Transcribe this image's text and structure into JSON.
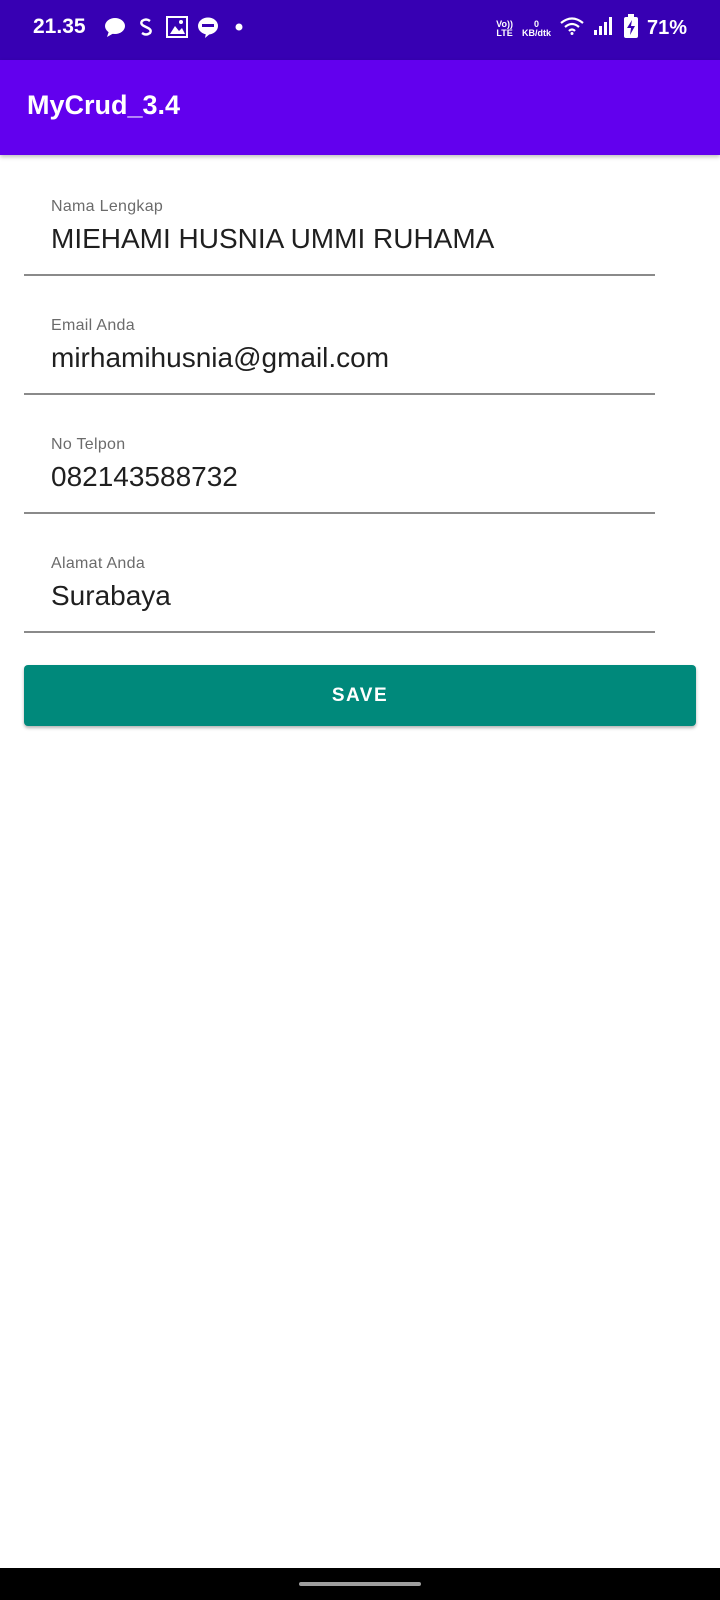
{
  "status_bar": {
    "time": "21.35",
    "notification_icons": [
      "chat-bubble-icon",
      "sync-icon",
      "gallery-icon",
      "line-icon",
      "dot-icon"
    ],
    "volte": "Vo))",
    "lte": "LTE",
    "data_speed_value": "0",
    "data_speed_unit": "KB/dtk",
    "battery_percent": "71%"
  },
  "app_bar": {
    "title": "MyCrud_3.4",
    "color": "#6200ee"
  },
  "form": {
    "fields": [
      {
        "label": "Nama Lengkap",
        "value": "MIEHAMI HUSNIA UMMI RUHAMA"
      },
      {
        "label": "Email Anda",
        "value": "mirhamihusnia@gmail.com"
      },
      {
        "label": "No Telpon",
        "value": "082143588732"
      },
      {
        "label": "Alamat Anda",
        "value": "Surabaya"
      }
    ],
    "save_label": "SAVE",
    "save_color": "#00897b"
  }
}
